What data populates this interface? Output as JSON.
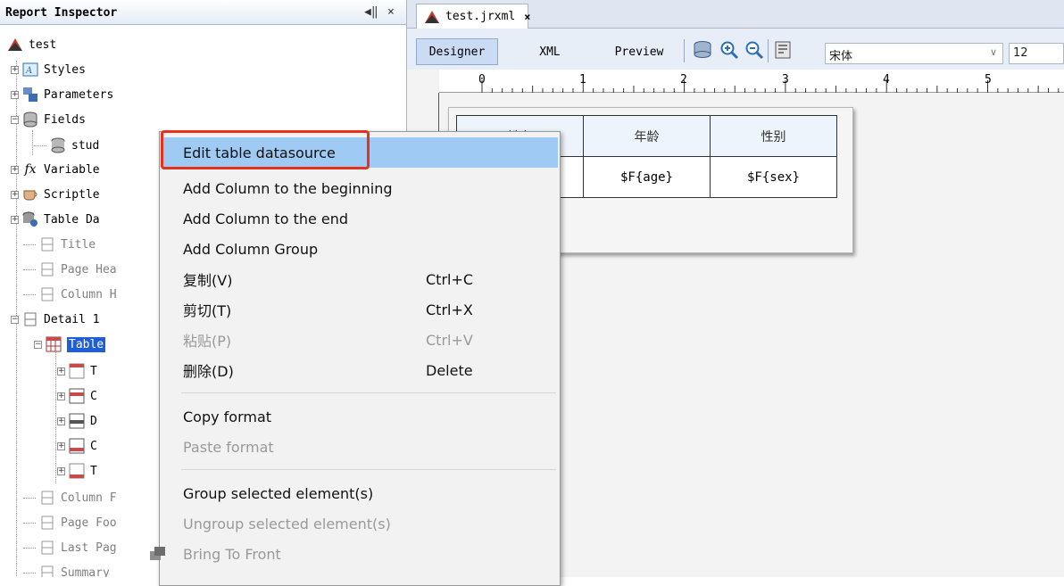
{
  "inspector": {
    "title": "Report Inspector",
    "controls": [
      "◀‖",
      "×"
    ],
    "tree": [
      {
        "label": "test"
      },
      {
        "label": "Styles"
      },
      {
        "label": "Parameters"
      },
      {
        "label": "Fields"
      },
      {
        "label": "stud"
      },
      {
        "label": "Variable"
      },
      {
        "label": "Scriptle"
      },
      {
        "label": "Table Da"
      },
      {
        "label": "Title"
      },
      {
        "label": "Page Hea"
      },
      {
        "label": "Column H"
      },
      {
        "label": "Detail 1"
      },
      {
        "label": "Table"
      },
      {
        "label": "T"
      },
      {
        "label": "C"
      },
      {
        "label": "D"
      },
      {
        "label": "C"
      },
      {
        "label": "T"
      },
      {
        "label": "Column F"
      },
      {
        "label": "Page Foo"
      },
      {
        "label": "Last Pag"
      },
      {
        "label": "Summary"
      }
    ]
  },
  "editor": {
    "file_tab": "test.jrxml",
    "file_tab_close": "×",
    "view_tabs": [
      "Designer",
      "XML",
      "Preview"
    ],
    "font_name": "宋体",
    "font_size": "12",
    "ruler_numbers": [
      "0",
      "1",
      "2",
      "3",
      "4",
      "5"
    ],
    "table": {
      "headers": [
        "姓名",
        "年龄",
        "性别"
      ],
      "detail": [
        "",
        "$F{age}",
        "$F{sex}"
      ]
    }
  },
  "context_menu": {
    "items": [
      {
        "label": "Edit table datasource",
        "accel": "",
        "disabled": false
      },
      {
        "label": "Add Column to the beginning",
        "accel": "",
        "disabled": false
      },
      {
        "label": "Add Column to the end",
        "accel": "",
        "disabled": false
      },
      {
        "label": "Add Column Group",
        "accel": "",
        "disabled": false
      },
      {
        "label": "复制(V)",
        "accel": "Ctrl+C",
        "disabled": false
      },
      {
        "label": "剪切(T)",
        "accel": "Ctrl+X",
        "disabled": false
      },
      {
        "label": "粘贴(P)",
        "accel": "Ctrl+V",
        "disabled": true
      },
      {
        "label": "删除(D)",
        "accel": "Delete",
        "disabled": false
      },
      {
        "label": "Copy format",
        "accel": "",
        "disabled": false
      },
      {
        "label": "Paste format",
        "accel": "",
        "disabled": true
      },
      {
        "label": "Group selected element(s)",
        "accel": "",
        "disabled": false
      },
      {
        "label": "Ungroup selected element(s)",
        "accel": "",
        "disabled": true
      },
      {
        "label": "Bring To Front",
        "accel": "",
        "disabled": true
      }
    ]
  },
  "colors": {
    "menu_hover": "#9fcaf3",
    "highlight_box": "#e8311d",
    "tree_selection": "#1e5fd7"
  }
}
